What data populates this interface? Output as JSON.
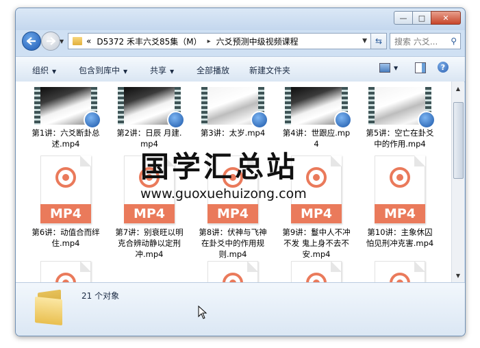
{
  "address": {
    "chevron": "«",
    "segments": [
      "D5372 禾丰六爻85集（M）",
      "六爻预测中级视频课程"
    ],
    "separator": "▸"
  },
  "search": {
    "placeholder": "搜索 六爻..."
  },
  "toolbar": {
    "organize": "组织",
    "include_in_library": "包含到库中",
    "share": "共享",
    "play_all": "全部播放",
    "new_folder": "新建文件夹"
  },
  "files": [
    {
      "name": "第1讲：六爻断卦总述.mp4",
      "kind": "video"
    },
    {
      "name": "第2讲：日辰 月建.mp4",
      "kind": "video"
    },
    {
      "name": "第3讲：太岁.mp4",
      "kind": "video"
    },
    {
      "name": "第4讲：世跟应.mp4",
      "kind": "video"
    },
    {
      "name": "第5讲：空亡在卦爻中的作用.mp4",
      "kind": "video"
    },
    {
      "name": "第6讲：动值合而绊住.mp4",
      "kind": "mp4"
    },
    {
      "name": "第7讲：别衰旺以明克合辨动静以定刑冲.mp4",
      "kind": "mp4"
    },
    {
      "name": "第8讲：伏神与飞神在卦爻中的作用规则.mp4",
      "kind": "mp4"
    },
    {
      "name": "第9讲：鬘中人不冲不发  鬼上身不去不安.mp4",
      "kind": "mp4"
    },
    {
      "name": "第10讲：主象休囚怕见刑冲克害.mp4",
      "kind": "mp4"
    }
  ],
  "mp4_badge": "MP4",
  "watermark": {
    "title": "国学汇总站",
    "url": "www.guoxuehuizong.com"
  },
  "status": {
    "count": "21 个对象"
  }
}
